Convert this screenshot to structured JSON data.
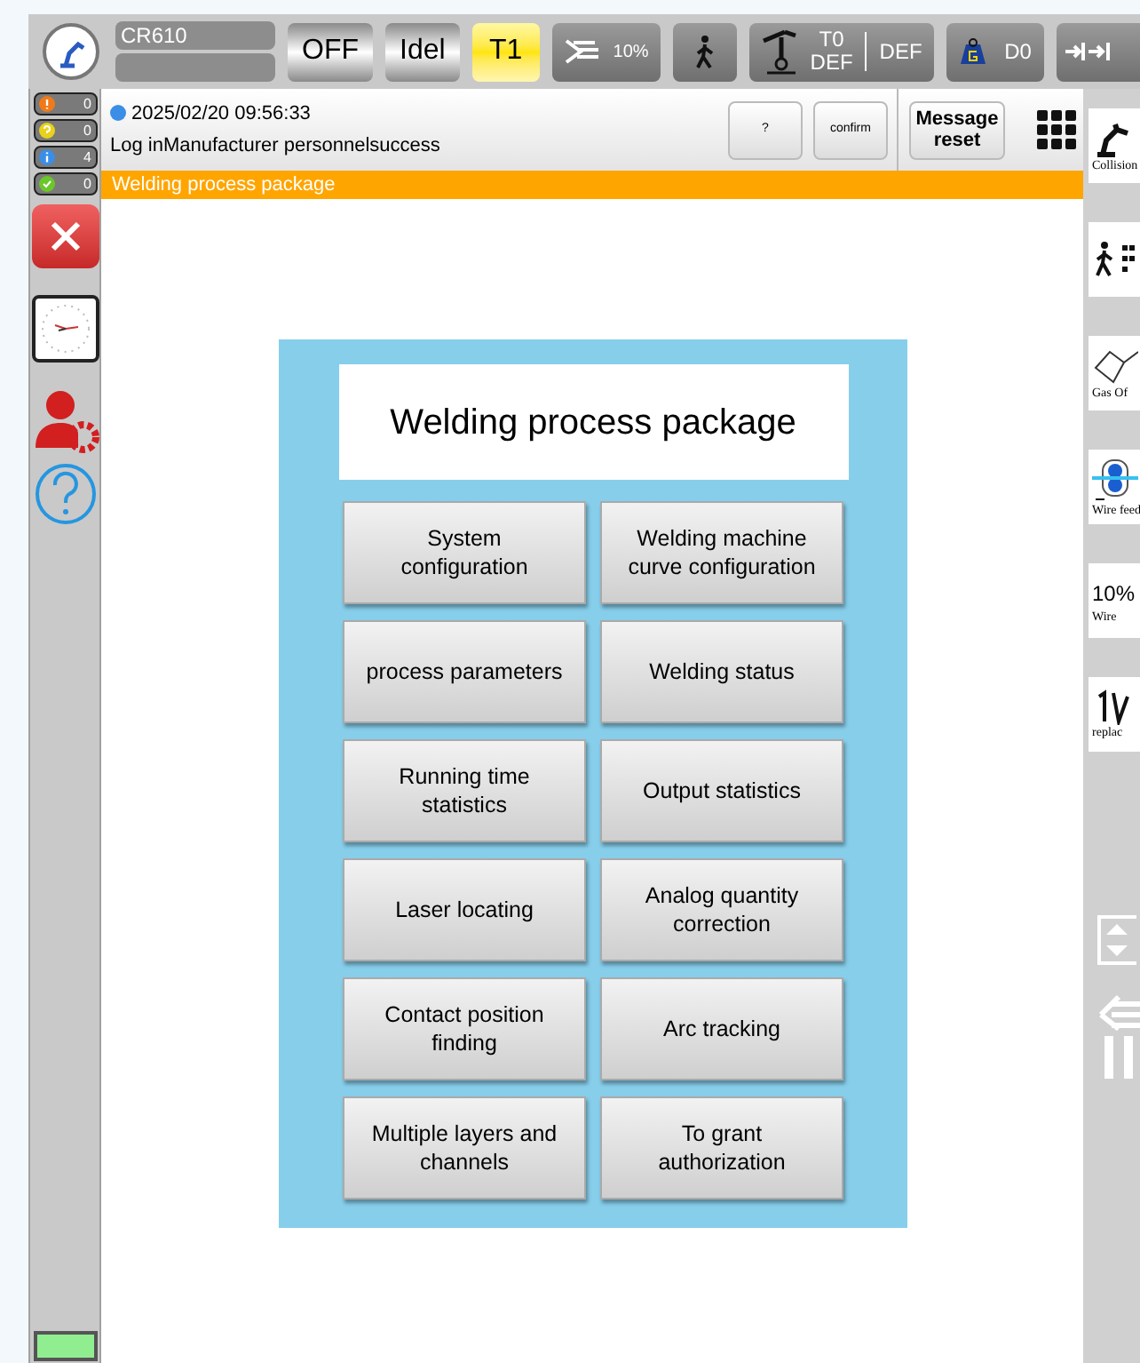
{
  "top_bar": {
    "robot_model": "CR610",
    "mode_buttons": [
      {
        "label": "OFF",
        "selected": false
      },
      {
        "label": "Idel",
        "selected": false
      },
      {
        "label": "T1",
        "selected": true
      }
    ],
    "speed": "10%",
    "tool": {
      "tool": "T0",
      "frame": "DEF",
      "user": "DEF"
    },
    "payload": "D0"
  },
  "alarm_counters": [
    {
      "kind": "error",
      "count": "0",
      "color": "#f07a1a"
    },
    {
      "kind": "warning",
      "count": "0",
      "color": "#e8d21a"
    },
    {
      "kind": "info",
      "count": "4",
      "color": "#3a8ee6"
    },
    {
      "kind": "ok",
      "count": "0",
      "color": "#6cc72a"
    }
  ],
  "message": {
    "timestamp": "2025/02/20 09:56:33",
    "text": "Log inManufacturer personnelsuccess",
    "buttons": [
      "?",
      "confirm"
    ],
    "reset": "Message reset"
  },
  "page_title": "Welding process package",
  "panel": {
    "title": "Welding process package",
    "buttons": [
      {
        "label": "System configuration"
      },
      {
        "label": "process parameters"
      },
      {
        "label": "Running time statistics"
      },
      {
        "label": "Laser locating"
      },
      {
        "label": "Contact position finding"
      },
      {
        "label": "Multiple layers and channels"
      },
      {
        "label": "Welding machine curve configuration"
      },
      {
        "label": "Welding status"
      },
      {
        "label": "Output statistics"
      },
      {
        "label": "Analog quantity correction"
      },
      {
        "label": "Arc tracking"
      },
      {
        "label": "To grant authorization"
      }
    ]
  },
  "right_tools": [
    {
      "kind": "robot",
      "label": "Collision"
    },
    {
      "kind": "walker"
    },
    {
      "kind": "gas",
      "label": "Gas Of"
    },
    {
      "kind": "feed",
      "label": "Wire feed"
    },
    {
      "kind": "text",
      "value": "10%",
      "label": "Wire"
    },
    {
      "kind": "replace",
      "label": "replac"
    }
  ]
}
